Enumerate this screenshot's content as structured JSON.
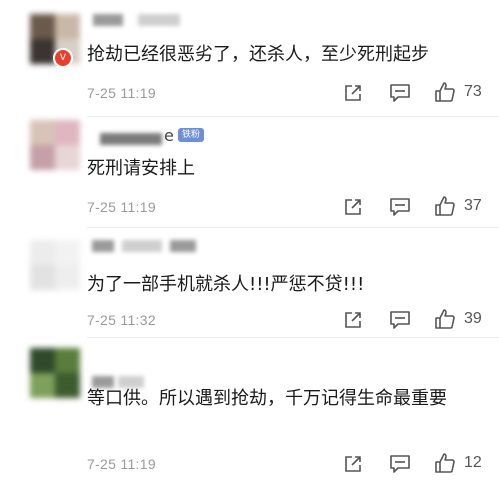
{
  "comments": [
    {
      "text": "抢劫已经很恶劣了，还杀人，至少死刑起步",
      "time": "7-25 11:19",
      "likes": "73",
      "verified_badge": "V"
    },
    {
      "name_tail": "e",
      "fan_badge": "铁粉",
      "text": "死刑请安排上",
      "time": "7-25 11:19",
      "likes": "37"
    },
    {
      "text": "为了一部手机就杀人!!!严惩不贷!!!",
      "time": "7-25 11:32",
      "likes": "39"
    },
    {
      "text": "等口供。所以遇到抢劫，千万记得生命最重要",
      "time": "7-25 11:19",
      "likes": "12"
    }
  ],
  "icons": {
    "share": "share-icon",
    "comment": "comment-icon",
    "like": "thumbs-up-icon"
  },
  "colors": {
    "verified_badge": "#e8402f",
    "fan_badge": "#6d8fd4",
    "meta_text": "#9a9a9a"
  }
}
